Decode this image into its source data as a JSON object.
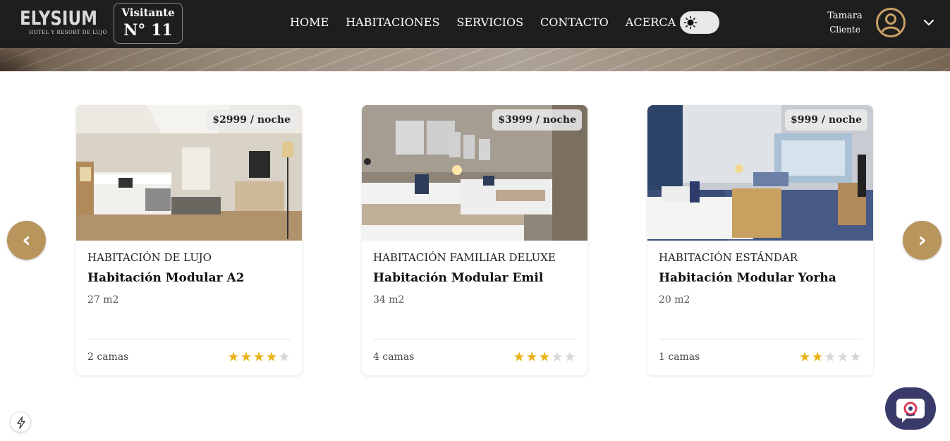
{
  "header": {
    "logo_main": "ELYSIUM",
    "logo_sub": "HOTEL Y RESORT DE LUJO",
    "visitor_title": "Visitante",
    "visitor_number": "N° 11",
    "nav": [
      "HOME",
      "HABITACIONES",
      "SERVICIOS",
      "CONTACTO",
      "ACERCA DE..."
    ],
    "theme_toggle_icon": "sun-icon",
    "user_name": "Tamara",
    "user_role": "Cliente",
    "avatar_icon": "user-circle-icon",
    "menu_icon": "chevron-down-icon"
  },
  "carousel": {
    "prev_label": "‹",
    "next_label": "›",
    "rooms": [
      {
        "price": "$2999 / noche",
        "category": "HABITACIÓN DE LUJO",
        "name": "Habitación Modular A2",
        "area": "27 m2",
        "beds": "2 camas",
        "rating": 4,
        "max_rating": 5
      },
      {
        "price": "$3999 / noche",
        "category": "HABITACIÓN FAMILIAR DELUXE",
        "name": "Habitación Modular Emil",
        "area": "34 m2",
        "beds": "4 camas",
        "rating": 3,
        "max_rating": 5
      },
      {
        "price": "$999 / noche",
        "category": "HABITACIÓN ESTÁNDAR",
        "name": "Habitación Modular Yorha",
        "area": "20 m2",
        "beds": "1 camas",
        "rating": 2,
        "max_rating": 5
      }
    ]
  },
  "floating": {
    "chat_icon": "chat-bot-icon",
    "bolt_icon": "lightning-icon"
  },
  "colors": {
    "header_bg": "#1e1e1e",
    "accent_gold": "#b8955c",
    "star_on": "#e9b31a",
    "star_off": "#d6d6d6",
    "chat_bg": "#3a3a6a"
  }
}
